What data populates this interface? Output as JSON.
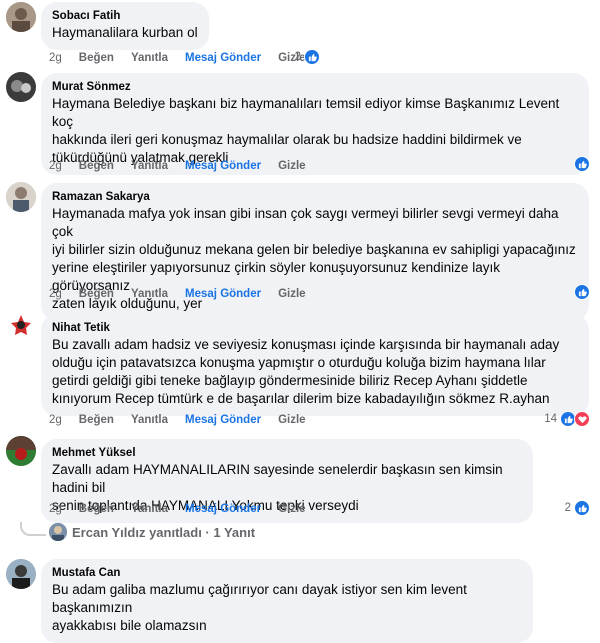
{
  "action_labels": {
    "time": "2g",
    "like": "Beğen",
    "reply": "Yanıtla",
    "message": "Mesaj Gönder",
    "hide": "Gizle"
  },
  "comments": [
    {
      "author": "Sobacı Fatih",
      "lines": [
        "Haymanalilara kurban ol"
      ],
      "reaction_count": "2",
      "reactions": [
        "like"
      ]
    },
    {
      "author": "Murat Sönmez",
      "lines": [
        "Haymana Belediye başkanı biz haymanalıları temsil ediyor kimse Başkanımız Levent koç",
        "hakkında ileri geri konuşmaz haymalılar olarak bu hadsize haddini bildirmek ve",
        "tükürdüğünü yalatmak gerekli"
      ],
      "reaction_count": "",
      "reactions": [
        "like"
      ]
    },
    {
      "author": "Ramazan Sakarya",
      "lines": [
        "Haymanada mafya yok insan gibi insan çok saygı vermeyi bilirler sevgi vermeyi daha çok",
        "iyi bilirler sizin olduğunuz mekana gelen bir belediye başkanına ev sahipligi yapacağınız",
        "yerine eleştiriler yapıyorsunuz çirkin söyler konuşuyorsunuz kendinize layık görüyorsanız",
        "zaten layık olduğunu, yer"
      ],
      "reaction_count": "",
      "reactions": [
        "like"
      ]
    },
    {
      "author": "Nihat Tetik",
      "lines": [
        "Bu zavallı adam hadsiz ve seviyesiz konuşması içinde karşısında bir haymanalı aday",
        "olduğu için patavatsızca konuşma yapmıştır o oturduğu koluğa bizim haymana lılar",
        "getirdi geldiği gibi teneke bağlayıp göndermesinide biliriz Recep Ayhanı şiddetle",
        "kınıyorum Recep tümtürk e de başarılar dilerim bize kabadayılığın sökmez R.ayhan"
      ],
      "reaction_count": "14",
      "reactions": [
        "like",
        "love"
      ]
    },
    {
      "author": "Mehmet Yüksel",
      "lines": [
        "Zavallı adam HAYMANALILARIN sayesinde senelerdir başkasın sen kimsin hadini bil",
        "senin toplantıda HAYMANALI Yokmu tepki verseydi"
      ],
      "reaction_count": "2",
      "reactions": [
        "like"
      ]
    },
    {
      "author": "Mustafa Can",
      "lines": [
        "Bu adam galiba mazlumu çağırırıyor canı dayak istiyor sen kim levent başkanımızın",
        "ayakkabısı bile olamazsın"
      ],
      "reaction_count": "",
      "reactions": []
    }
  ],
  "reply_summary": {
    "text": "Ercan Yıldız yanıtladı · 1 Yanıt"
  },
  "colors": {
    "accent": "#1b74e4",
    "bubble": "#f0f2f5",
    "muted": "#65676b",
    "love": "#f33e58"
  }
}
